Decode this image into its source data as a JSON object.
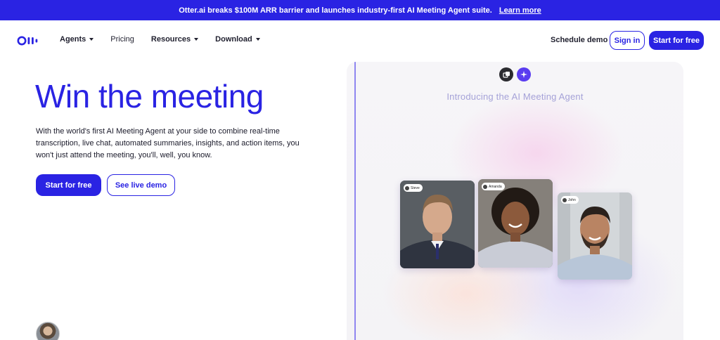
{
  "banner": {
    "text": "Otter.ai breaks $100M ARR barrier and launches industry-first AI Meeting Agent suite.",
    "link": "Learn more"
  },
  "nav": {
    "items": [
      {
        "label": "Agents",
        "dropdown": true
      },
      {
        "label": "Pricing",
        "dropdown": false
      },
      {
        "label": "Resources",
        "dropdown": true
      },
      {
        "label": "Download",
        "dropdown": true
      }
    ],
    "schedule_demo": "Schedule demo",
    "sign_in": "Sign in",
    "start_for_free": "Start for free"
  },
  "hero": {
    "title": "Win the meeting",
    "description": "With the world's first AI Meeting Agent at your side to combine real-time transcription, live chat, automated summaries, insights, and action items, you won't just attend the meeting, you'll, well, you know.",
    "primary_button": "Start for free",
    "secondary_button": "See live demo"
  },
  "panel": {
    "title": "Introducing the AI Meeting Agent",
    "participants": [
      {
        "name": "Steve"
      },
      {
        "name": "Amanda"
      },
      {
        "name": "John"
      }
    ]
  },
  "colors": {
    "brand": "#2a23e3",
    "panel_title": "#a5a2d8"
  }
}
